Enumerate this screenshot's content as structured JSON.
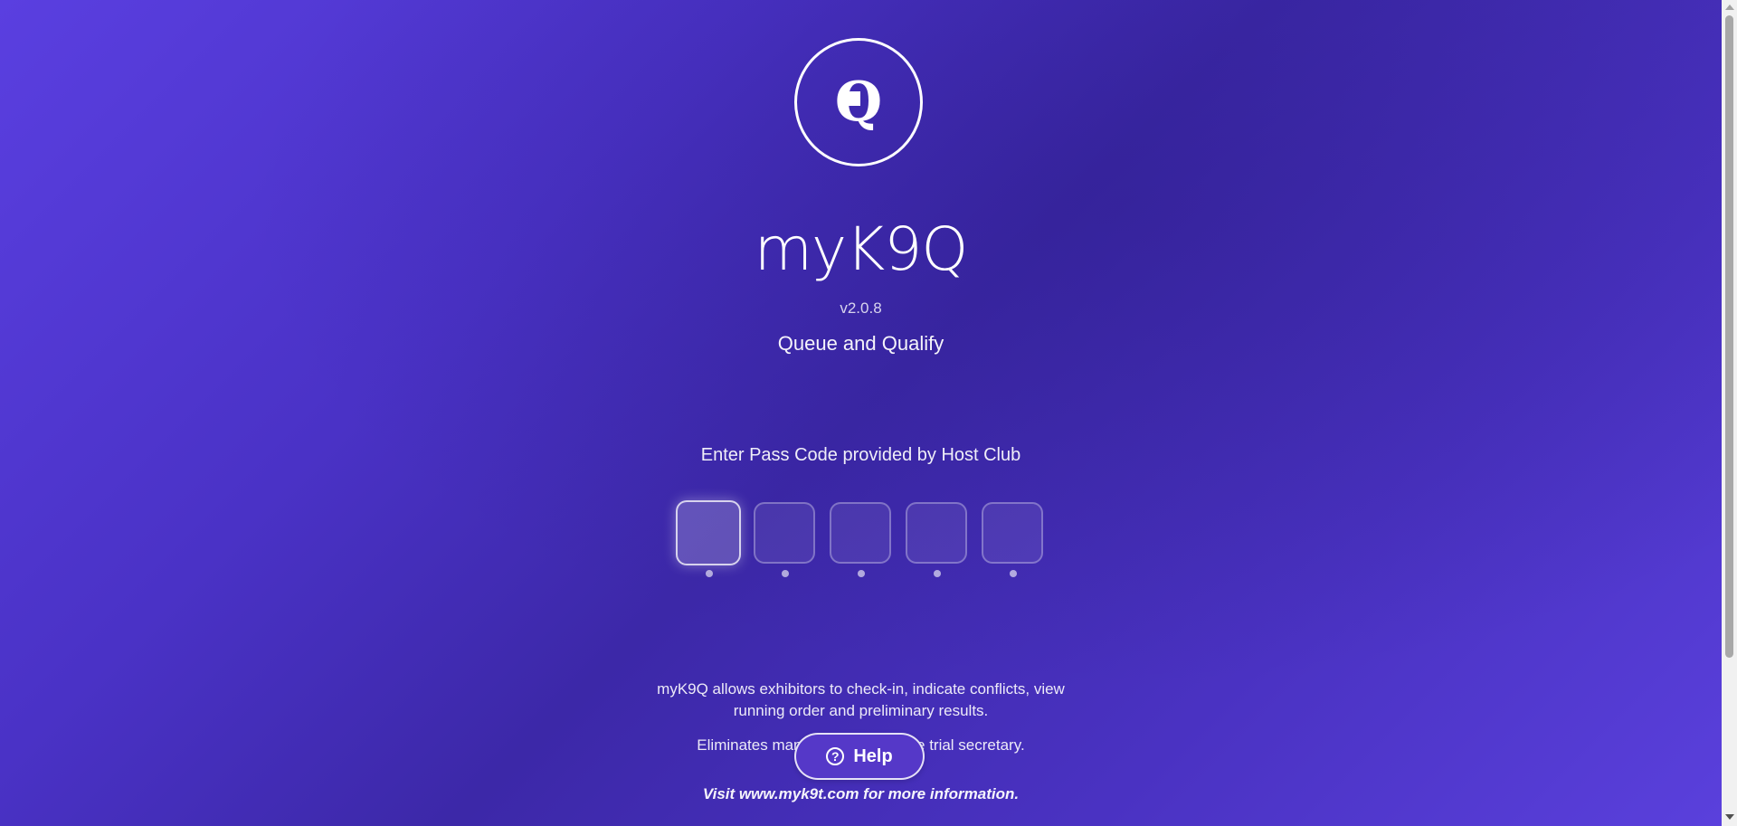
{
  "app": {
    "title": "myK9Q",
    "logo_letter": "Q",
    "version": "v2.0.8",
    "tagline": "Queue and Qualify"
  },
  "passcode": {
    "prompt": "Enter Pass Code provided by Host Club",
    "digits": [
      "",
      "",
      "",
      "",
      ""
    ],
    "active_index": 0
  },
  "info": {
    "description": "myK9Q allows exhibitors to check-in, indicate conflicts, view running order and preliminary results.",
    "eliminates": "Eliminates many ... the trial secretary.",
    "eliminates_left": "Eliminates many",
    "eliminates_right": "e trial secretary.",
    "visit": "Visit www.myk9t.com for more information."
  },
  "help": {
    "label": "Help",
    "icon": "question-circle-icon"
  },
  "colors": {
    "background_start": "#5a3fe0",
    "background_mid": "#3c28a8",
    "text": "#ffffff"
  }
}
